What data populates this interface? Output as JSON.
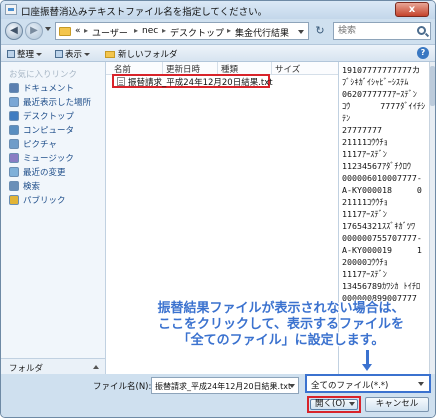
{
  "window": {
    "title": "口座振替消込みテキストファイル名を指定してください。",
    "close_label": "x"
  },
  "nav": {
    "back_glyph": "◀",
    "forward_glyph": "▶",
    "refresh_glyph": "↻",
    "breadcrumb": [
      {
        "label": "«",
        "sep": "▸"
      },
      {
        "label": "ユーザー",
        "sep": "▸"
      },
      {
        "label": "nec",
        "sep": "▸"
      },
      {
        "label": "デスクトップ",
        "sep": "▸"
      },
      {
        "label": "集金代行結果",
        "sep": ""
      }
    ],
    "search_placeholder": "検索"
  },
  "toolbar": {
    "organize_label": "整理",
    "view_label": "表示",
    "new_folder_label": "新しいフォルダ",
    "help_glyph": "?"
  },
  "sidebar": {
    "heading": "お気に入りリンク",
    "items": [
      {
        "label": "ドキュメント",
        "icon": "document-icon",
        "color": "#5b7fb0"
      },
      {
        "label": "最近表示した場所",
        "icon": "recent-places-icon",
        "color": "#7aa7d6"
      },
      {
        "label": "デスクトップ",
        "icon": "desktop-icon",
        "color": "#3f7cc1"
      },
      {
        "label": "コンピュータ",
        "icon": "computer-icon",
        "color": "#5a8ec0"
      },
      {
        "label": "ピクチャ",
        "icon": "pictures-icon",
        "color": "#6f9cc9"
      },
      {
        "label": "ミュージック",
        "icon": "music-icon",
        "color": "#8a7dc4"
      },
      {
        "label": "最近の変更",
        "icon": "recent-changes-icon",
        "color": "#7fb0d9"
      },
      {
        "label": "検索",
        "icon": "search-folder-icon",
        "color": "#6a8fb8"
      },
      {
        "label": "パブリック",
        "icon": "public-folder-icon",
        "color": "#e2b436"
      }
    ],
    "folder_pane_label": "フォルダ"
  },
  "columns": [
    "名前",
    "更新日時",
    "種類",
    "サイズ"
  ],
  "files": [
    {
      "name": "振替請求_平成24年12月20日結果.txt"
    }
  ],
  "preview": {
    "lines": [
      "19107777777777カ",
      "ﾌﾞｼｷｶﾞｲｼｬﾋﾞｰｼｽﾃﾑ",
      "0620777777ｱｰｽﾃﾞﾝ",
      "ｺｳ      7777ﾀﾞｲｲﾁｼ",
      "ﾃﾝ",
      "27777777",
      "21111ｺｳｳﾁｮ",
      "1117ｱｰｽﾃﾞﾝ",
      "11234567ｱﾀﾞﾁｸﾛｳ",
      "000006010007777-",
      "A-KY000018     0",
      "21111ｺｳｳﾁｮ",
      "1117ｱｰｽﾃﾞﾝ",
      "17654321ｽｽﾞｷｶﾞﾂﾜ",
      "000000755707777-",
      "A-KY000019     1",
      "20000ｺｳｳﾁｮ",
      "1117ｱｰｽﾃﾞﾝ",
      "13456789ｶﾜｼｶ ﾄｲﾁﾛ",
      "000000899007777"
    ]
  },
  "annotation": {
    "lines": [
      "振替結果ファイルが表示されない場合は、",
      "ここをクリックして、表示するファイルを",
      "「全てのファイル」に設定します。"
    ],
    "color": "#3b72cf"
  },
  "bottom": {
    "filename_label": "ファイル名(N):",
    "filename_value": "振替請求_平成24年12月20日結果.txt",
    "filetype_value": "全てのファイル(*.*)",
    "open_label": "開く(O)",
    "cancel_label": "キャンセル"
  },
  "colors": {
    "highlight_red": "#d8232a",
    "highlight_blue": "#3b72cf"
  }
}
